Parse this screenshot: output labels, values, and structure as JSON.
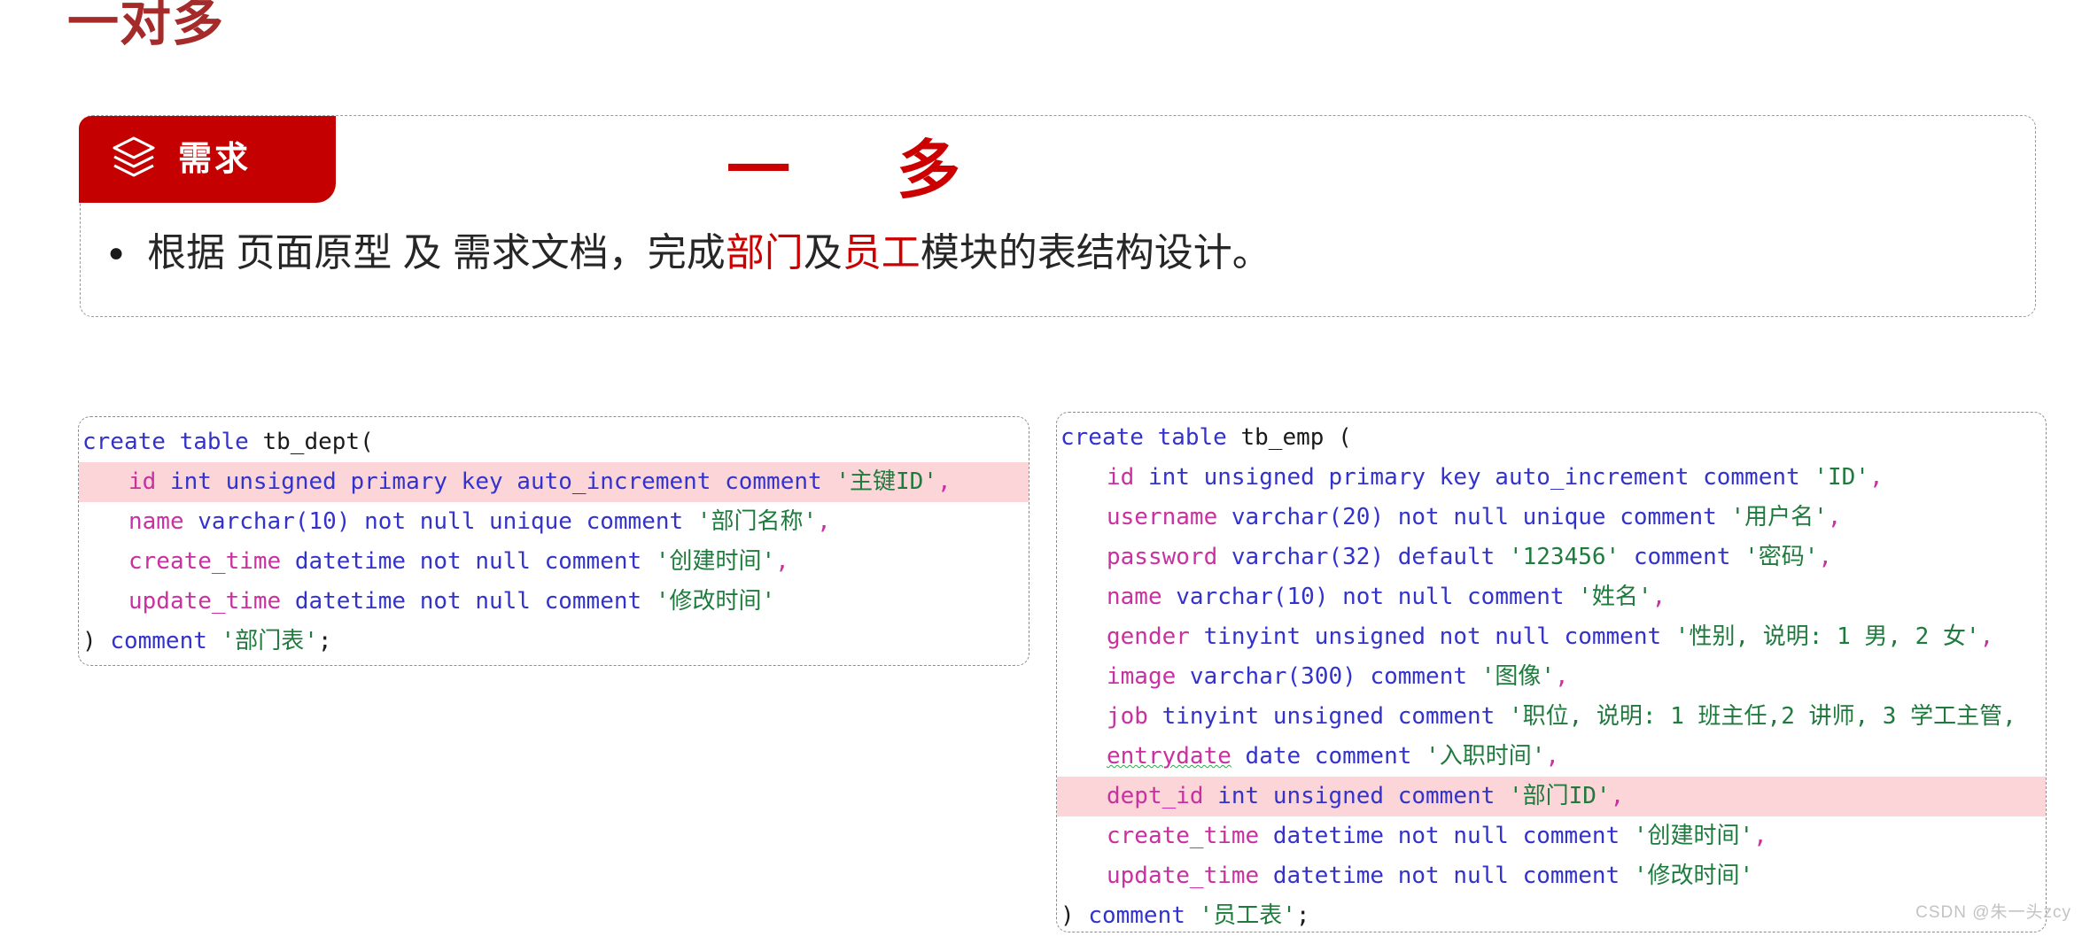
{
  "page": {
    "title": "一对多",
    "title_color": "#a52a2a",
    "background": "#ffffff"
  },
  "requirement": {
    "tag_label": "需求",
    "tag_icon": "layers-icon",
    "tag_bg": "#c40000",
    "relation_caption": "一      多",
    "relation_color": "#cc0000",
    "bullet_glyph": "●",
    "line_parts": [
      {
        "text": "根据 页面原型 及 需求文档，完成",
        "highlight": false
      },
      {
        "text": "部门",
        "highlight": true
      },
      {
        "text": "及",
        "highlight": false
      },
      {
        "text": "员工",
        "highlight": true
      },
      {
        "text": "模块的表结构设计。",
        "highlight": false
      }
    ]
  },
  "code_dept": {
    "table": "tb_dept",
    "lines": [
      {
        "indent": false,
        "highlight": false,
        "tokens": [
          {
            "t": "create table ",
            "c": "kw"
          },
          {
            "t": "tb_dept(",
            "c": "plain"
          }
        ]
      },
      {
        "indent": true,
        "highlight": true,
        "tokens": [
          {
            "t": "id",
            "c": "col"
          },
          {
            "t": " int unsigned primary key auto_increment comment ",
            "c": "kw"
          },
          {
            "t": "'主键ID'",
            "c": "str"
          },
          {
            "t": ",",
            "c": "punct"
          }
        ]
      },
      {
        "indent": true,
        "highlight": false,
        "tokens": [
          {
            "t": "name",
            "c": "col"
          },
          {
            "t": " varchar(",
            "c": "kw"
          },
          {
            "t": "10",
            "c": "num"
          },
          {
            "t": ") not null unique comment ",
            "c": "kw"
          },
          {
            "t": "'部门名称'",
            "c": "str"
          },
          {
            "t": ",",
            "c": "punct"
          }
        ]
      },
      {
        "indent": true,
        "highlight": false,
        "tokens": [
          {
            "t": "create_time",
            "c": "col"
          },
          {
            "t": " datetime not null comment ",
            "c": "kw"
          },
          {
            "t": "'创建时间'",
            "c": "str"
          },
          {
            "t": ",",
            "c": "punct"
          }
        ]
      },
      {
        "indent": true,
        "highlight": false,
        "tokens": [
          {
            "t": "update_time",
            "c": "col"
          },
          {
            "t": " datetime not null comment ",
            "c": "kw"
          },
          {
            "t": "'修改时间'",
            "c": "str"
          }
        ]
      },
      {
        "indent": false,
        "highlight": false,
        "tokens": [
          {
            "t": ") ",
            "c": "plain"
          },
          {
            "t": "comment ",
            "c": "kw"
          },
          {
            "t": "'部门表'",
            "c": "str"
          },
          {
            "t": ";",
            "c": "plain"
          }
        ]
      }
    ]
  },
  "code_emp": {
    "table": "tb_emp",
    "lines": [
      {
        "indent": false,
        "highlight": false,
        "tokens": [
          {
            "t": "create table ",
            "c": "kw"
          },
          {
            "t": "tb_emp (",
            "c": "plain"
          }
        ]
      },
      {
        "indent": true,
        "highlight": false,
        "tokens": [
          {
            "t": "id",
            "c": "col"
          },
          {
            "t": " int unsigned primary key auto_increment comment ",
            "c": "kw"
          },
          {
            "t": "'ID'",
            "c": "str"
          },
          {
            "t": ",",
            "c": "punct"
          }
        ]
      },
      {
        "indent": true,
        "highlight": false,
        "tokens": [
          {
            "t": "username",
            "c": "col"
          },
          {
            "t": " varchar(",
            "c": "kw"
          },
          {
            "t": "20",
            "c": "num"
          },
          {
            "t": ") not null unique comment ",
            "c": "kw"
          },
          {
            "t": "'用户名'",
            "c": "str"
          },
          {
            "t": ",",
            "c": "punct"
          }
        ]
      },
      {
        "indent": true,
        "highlight": false,
        "tokens": [
          {
            "t": "password",
            "c": "col"
          },
          {
            "t": " varchar(",
            "c": "kw"
          },
          {
            "t": "32",
            "c": "num"
          },
          {
            "t": ") default ",
            "c": "kw"
          },
          {
            "t": "'123456'",
            "c": "str"
          },
          {
            "t": " comment ",
            "c": "kw"
          },
          {
            "t": "'密码'",
            "c": "str"
          },
          {
            "t": ",",
            "c": "punct"
          }
        ]
      },
      {
        "indent": true,
        "highlight": false,
        "tokens": [
          {
            "t": "name",
            "c": "col"
          },
          {
            "t": " varchar(",
            "c": "kw"
          },
          {
            "t": "10",
            "c": "num"
          },
          {
            "t": ") not null comment ",
            "c": "kw"
          },
          {
            "t": "'姓名'",
            "c": "str"
          },
          {
            "t": ",",
            "c": "punct"
          }
        ]
      },
      {
        "indent": true,
        "highlight": false,
        "tokens": [
          {
            "t": "gender",
            "c": "col"
          },
          {
            "t": " tinyint unsigned not null comment ",
            "c": "kw"
          },
          {
            "t": "'性别, 说明: 1 男, 2 女'",
            "c": "str"
          },
          {
            "t": ",",
            "c": "punct"
          }
        ]
      },
      {
        "indent": true,
        "highlight": false,
        "tokens": [
          {
            "t": "image",
            "c": "col"
          },
          {
            "t": " varchar(",
            "c": "kw"
          },
          {
            "t": "300",
            "c": "num"
          },
          {
            "t": ") comment ",
            "c": "kw"
          },
          {
            "t": "'图像'",
            "c": "str"
          },
          {
            "t": ",",
            "c": "punct"
          }
        ]
      },
      {
        "indent": true,
        "highlight": false,
        "tokens": [
          {
            "t": "job",
            "c": "col"
          },
          {
            "t": " tinyint unsigned comment ",
            "c": "kw"
          },
          {
            "t": "'职位, 说明: 1 班主任,2 讲师, 3 学工主管,",
            "c": "str"
          }
        ]
      },
      {
        "indent": true,
        "highlight": false,
        "tokens": [
          {
            "t": "entrydate",
            "c": "spell"
          },
          {
            "t": " date comment ",
            "c": "kw"
          },
          {
            "t": "'入职时间'",
            "c": "str"
          },
          {
            "t": ",",
            "c": "punct"
          }
        ]
      },
      {
        "indent": true,
        "highlight": true,
        "tokens": [
          {
            "t": "dept_id",
            "c": "col"
          },
          {
            "t": " int unsigned comment ",
            "c": "kw"
          },
          {
            "t": "'部门ID'",
            "c": "str"
          },
          {
            "t": ",",
            "c": "punct"
          }
        ]
      },
      {
        "indent": true,
        "highlight": false,
        "tokens": [
          {
            "t": "create_time",
            "c": "col"
          },
          {
            "t": " datetime not null comment ",
            "c": "kw"
          },
          {
            "t": "'创建时间'",
            "c": "str"
          },
          {
            "t": ",",
            "c": "punct"
          }
        ]
      },
      {
        "indent": true,
        "highlight": false,
        "tokens": [
          {
            "t": "update_time",
            "c": "col"
          },
          {
            "t": " datetime not null comment ",
            "c": "kw"
          },
          {
            "t": "'修改时间'",
            "c": "str"
          }
        ]
      },
      {
        "indent": false,
        "highlight": false,
        "tokens": [
          {
            "t": ") ",
            "c": "plain"
          },
          {
            "t": "comment ",
            "c": "kw"
          },
          {
            "t": "'员工表'",
            "c": "str"
          },
          {
            "t": ";",
            "c": "plain"
          }
        ]
      }
    ]
  },
  "watermark": {
    "text": "CSDN @朱一头zcy"
  }
}
